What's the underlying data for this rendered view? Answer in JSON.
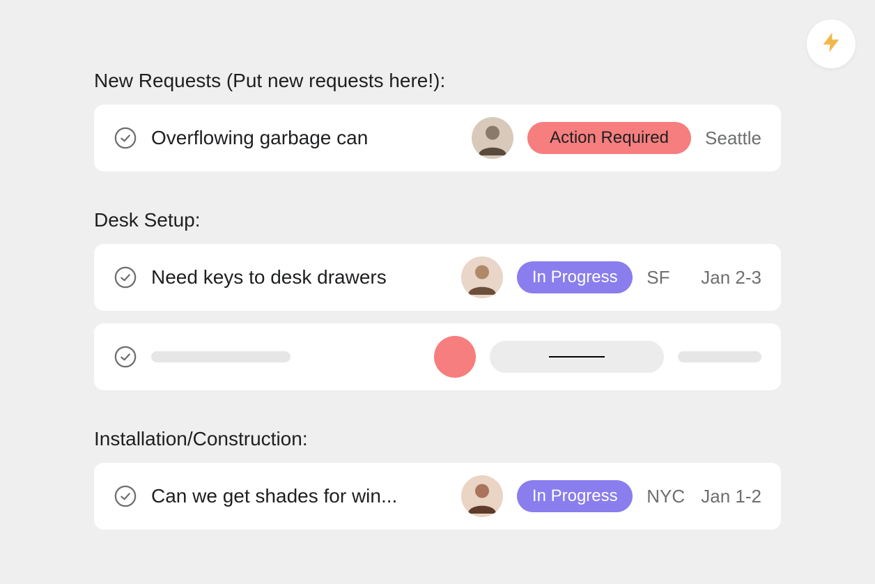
{
  "fab": {
    "icon": "bolt"
  },
  "status_colors": {
    "action_required": "#f67e7e",
    "in_progress": "#8a7ded"
  },
  "sections": [
    {
      "title": "New Requests (Put new requests here!):",
      "tasks": [
        {
          "title": "Overflowing garbage can",
          "status_label": "Action Required",
          "status_kind": "action",
          "location": "Seattle",
          "date": "",
          "assignee": "person-1",
          "placeholder": false
        }
      ]
    },
    {
      "title": "Desk Setup:",
      "tasks": [
        {
          "title": "Need keys to desk drawers",
          "status_label": "In Progress",
          "status_kind": "progress",
          "location": "SF",
          "date": "Jan 2-3",
          "assignee": "person-2",
          "placeholder": false
        },
        {
          "title": "",
          "status_label": "",
          "status_kind": "",
          "location": "",
          "date": "",
          "assignee": "rose-circle",
          "placeholder": true
        }
      ]
    },
    {
      "title": "Installation/Construction:",
      "tasks": [
        {
          "title": "Can we get shades for win...",
          "status_label": "In Progress",
          "status_kind": "progress",
          "location": "NYC",
          "date": "Jan 1-2",
          "assignee": "person-3",
          "placeholder": false
        }
      ]
    }
  ]
}
